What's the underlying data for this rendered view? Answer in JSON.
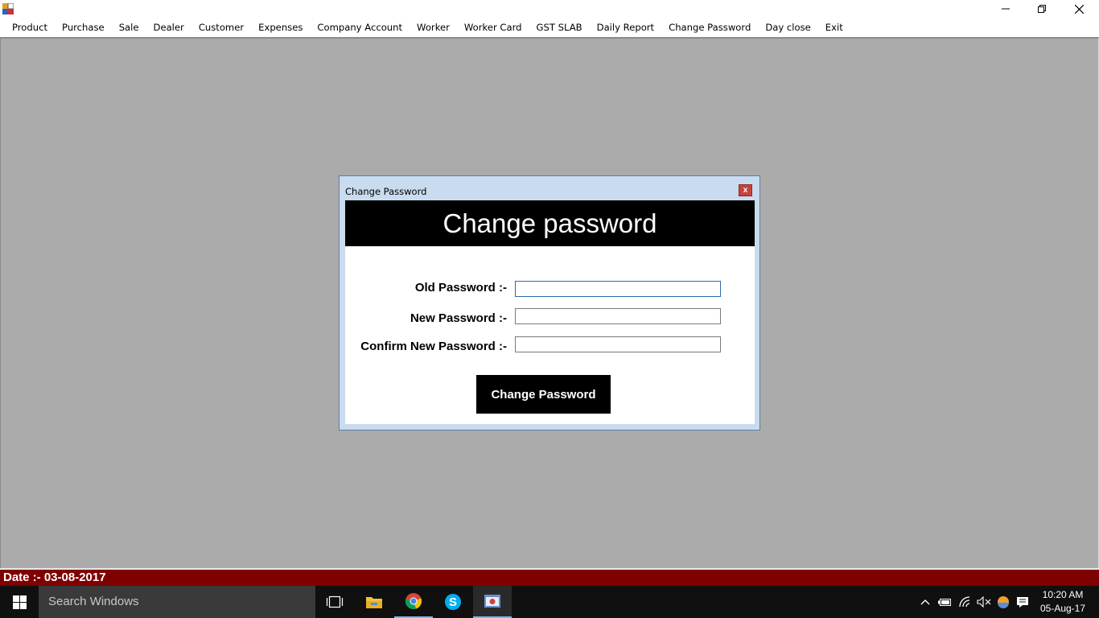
{
  "menu": {
    "items": [
      {
        "label": "Product"
      },
      {
        "label": "Purchase"
      },
      {
        "label": "Sale"
      },
      {
        "label": "Dealer"
      },
      {
        "label": "Customer"
      },
      {
        "label": "Expenses"
      },
      {
        "label": "Company Account"
      },
      {
        "label": "Worker"
      },
      {
        "label": "Worker Card"
      },
      {
        "label": "GST SLAB"
      },
      {
        "label": "Daily Report"
      },
      {
        "label": "Change Password"
      },
      {
        "label": "Day close"
      },
      {
        "label": "Exit"
      }
    ]
  },
  "dialog": {
    "title": "Change Password",
    "close_label": "x",
    "header": "Change password",
    "old_password_label": "Old Password :-",
    "new_password_label": "New Password :-",
    "confirm_password_label": "Confirm New Password :-",
    "old_password_value": "",
    "new_password_value": "",
    "confirm_password_value": "",
    "submit_label": "Change Password"
  },
  "status": {
    "date_text": "Date :- 03-08-2017"
  },
  "taskbar": {
    "search_placeholder": "Search Windows",
    "time": "10:20 AM",
    "date": "05-Aug-17"
  },
  "colors": {
    "status_bar": "#7f0000",
    "mdi_background": "#ababab",
    "dialog_header": "#000000",
    "dialog_close": "#c7423b"
  }
}
